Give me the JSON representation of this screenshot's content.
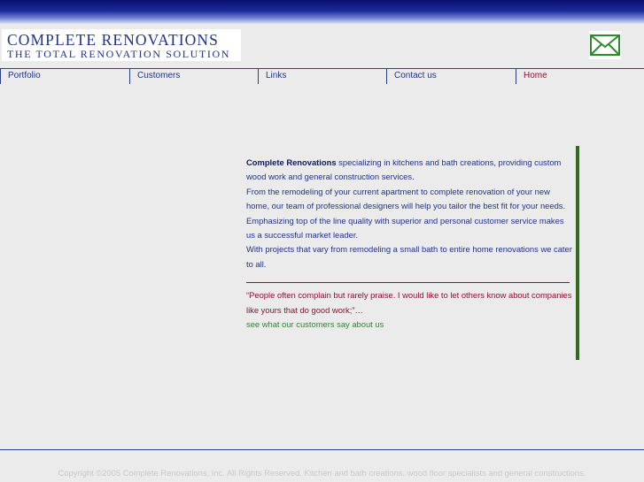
{
  "header": {
    "logo_line1": "COMPLETE RENOVATIONS",
    "logo_line2": "THE TOTAL RENOVATION SOLUTION",
    "mail_icon": "envelope-icon",
    "colors": {
      "brand_blue": "#1f3486",
      "accent_red": "#8a1230",
      "accent_green": "#2a8a2a"
    }
  },
  "nav": {
    "items": [
      {
        "label": "Portfolio"
      },
      {
        "label": "Customers"
      },
      {
        "label": "Links"
      },
      {
        "label": "Contact us"
      },
      {
        "label": "Home"
      }
    ]
  },
  "main": {
    "company_name": "Complete Renovations",
    "intro_rest": " specializing in kitchens and bath creations, providing custom wood work and general construction services.",
    "para2": "From the remodeling of your current apartment to complete renovation of your new home, our team of professional designers will help you tailor the best fit for your needs.",
    "para3": "Emphasizing top of the line quality with superior and personal customer service makes us a successful market leader.",
    "para4": "With projects that vary from remodeling a small bath to entire home renovations we cater to all.",
    "quote": "“People often complain but rarely praise. I would like to let others know about companies like yours that do good work;”…",
    "customers_link": "see what our customers say about us"
  },
  "footer": {
    "text": "Copyright ©2005 Complete Renovations, Inc. All Rights Reserved. Kitchen and bath creations, wood floor specialists and general constructions."
  }
}
